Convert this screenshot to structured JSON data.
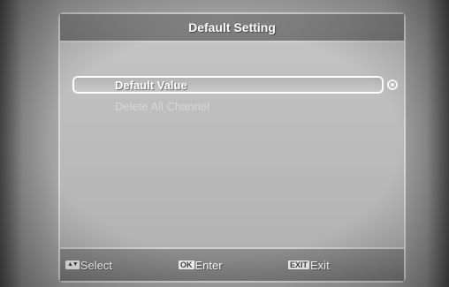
{
  "dialog": {
    "title": "Default Setting"
  },
  "menu": {
    "items": [
      {
        "label": "Default Value",
        "selected": true
      },
      {
        "label": "Delete All Channel",
        "selected": false
      }
    ]
  },
  "footer": {
    "select": {
      "key": "▲▼",
      "label": "Select"
    },
    "enter": {
      "key": "OK",
      "label": "Enter"
    },
    "exit": {
      "key": "EXIT",
      "label": "Exit"
    }
  }
}
